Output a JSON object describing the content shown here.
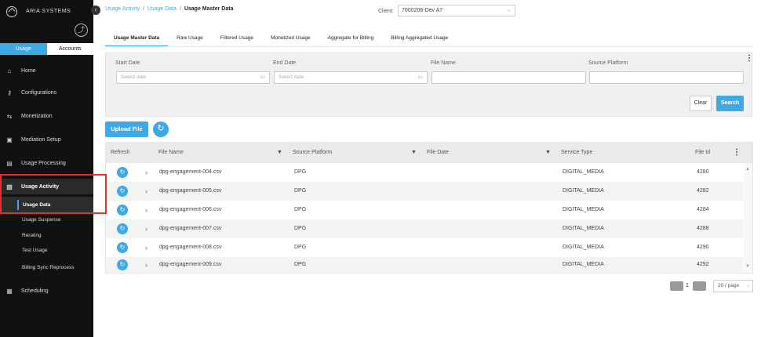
{
  "brand": {
    "name": "ARIA SYSTEMS"
  },
  "sidebar": {
    "top_tabs": [
      "Usage",
      "Accounts"
    ],
    "items": [
      {
        "label": "Home",
        "icon": "home-icon"
      },
      {
        "label": "Configurations",
        "icon": "key-icon"
      },
      {
        "label": "Monetization",
        "icon": "exchange-icon"
      },
      {
        "label": "Mediation Setup",
        "icon": "settings-box-icon"
      },
      {
        "label": "Usage Processing",
        "icon": "document-icon"
      },
      {
        "label": "Usage Activity",
        "icon": "activity-icon"
      }
    ],
    "sub_items": [
      "Usage Data",
      "Usage Suspense",
      "Rerating",
      "Test Usage",
      "Billing Sync Reprocess"
    ],
    "bottom_item": {
      "label": "Scheduling",
      "icon": "calendar-icon"
    }
  },
  "breadcrumb": {
    "crumb1": "Usage Activity",
    "crumb2": "Usage Data",
    "current": "Usage Master Data",
    "sep": "/"
  },
  "client": {
    "label": "Client:",
    "value": "7000206-Dev A7"
  },
  "subtabs": [
    "Usage Master Data",
    "Raw Usage",
    "Filtered Usage",
    "Monetized Usage",
    "Aggregate for Billing",
    "Billing Aggregated Usage"
  ],
  "filters": {
    "start_date": {
      "label": "Start Date",
      "placeholder": "Select date"
    },
    "end_date": {
      "label": "End Date",
      "placeholder": "Select date"
    },
    "file_name": {
      "label": "File Name",
      "placeholder": ""
    },
    "source_platform": {
      "label": "Source Platform",
      "placeholder": ""
    },
    "clear_label": "Clear",
    "search_label": "Search"
  },
  "upload_label": "Upload File",
  "table": {
    "columns": [
      "Refresh",
      "File Name",
      "Source Platform",
      "File Date",
      "Service Type",
      "File Id"
    ],
    "rows": [
      {
        "file_name": "dpg-engagement-004.csv",
        "source_platform": "DPG",
        "file_date": "",
        "service_type": "DIGITAL_MEDIA",
        "file_id": "4280"
      },
      {
        "file_name": "dpg-engagement-005.csv",
        "source_platform": "DPG",
        "file_date": "",
        "service_type": "DIGITAL_MEDIA",
        "file_id": "4282"
      },
      {
        "file_name": "dpg-engagement-006.csv",
        "source_platform": "DPG",
        "file_date": "",
        "service_type": "DIGITAL_MEDIA",
        "file_id": "4284"
      },
      {
        "file_name": "dpg-engagement-007.csv",
        "source_platform": "DPG",
        "file_date": "",
        "service_type": "DIGITAL_MEDIA",
        "file_id": "4288"
      },
      {
        "file_name": "dpg-engagement-008.csv",
        "source_platform": "DPG",
        "file_date": "",
        "service_type": "DIGITAL_MEDIA",
        "file_id": "4290"
      },
      {
        "file_name": "dpg-engagement-009.csv",
        "source_platform": "DPG",
        "file_date": "",
        "service_type": "DIGITAL_MEDIA",
        "file_id": "4292"
      }
    ]
  },
  "pagination": {
    "current_page": "1",
    "page_size": "20 / page"
  },
  "colors": {
    "accent": "#3fa9e5",
    "sidebar_bg": "#111111",
    "highlight": "#e03030"
  }
}
